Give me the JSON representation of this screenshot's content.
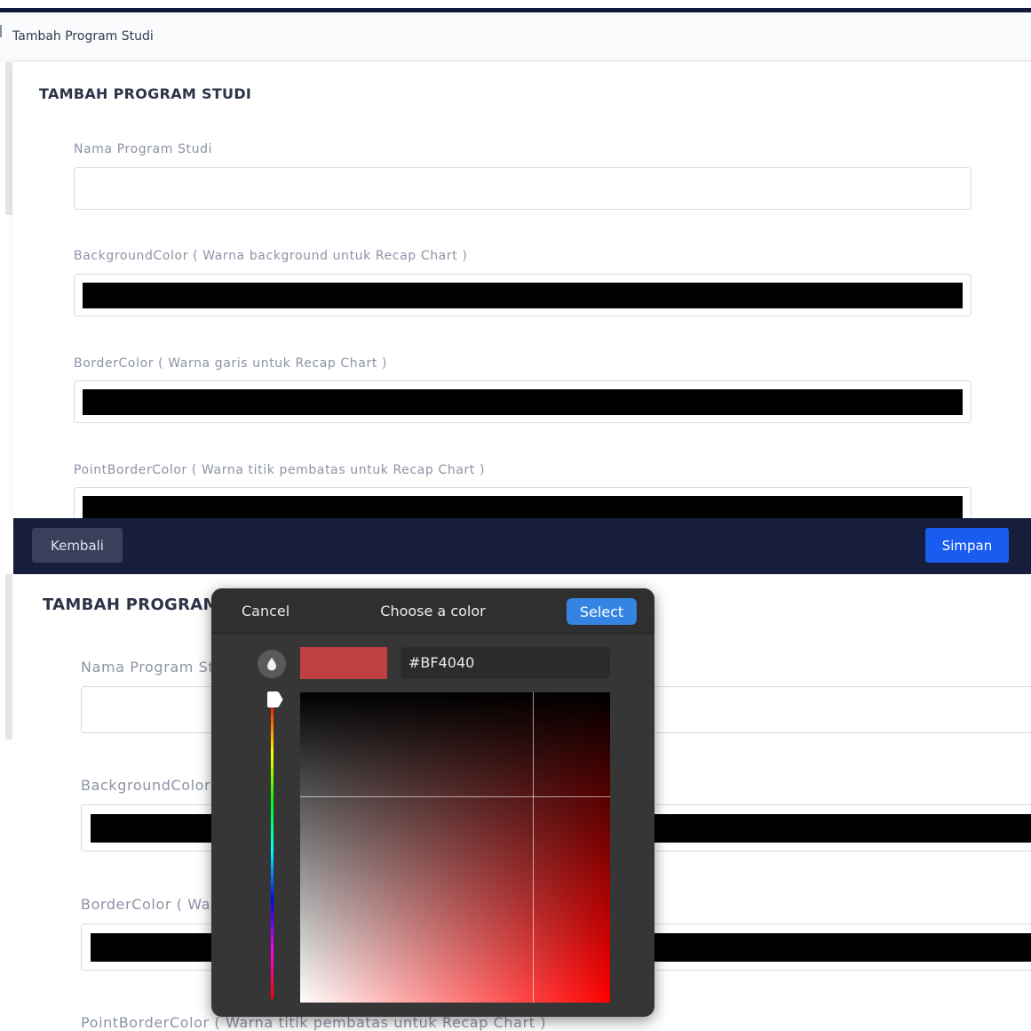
{
  "breadcrumb": "Tambah Program Studi",
  "form": {
    "title": "TAMBAH PROGRAM STUDI",
    "fields": [
      {
        "label": "Nama Program Studi",
        "value": ""
      },
      {
        "label": "BackgroundColor ( Warna background untuk Recap Chart )",
        "value": "#000000"
      },
      {
        "label": "BorderColor ( Warna garis untuk Recap Chart )",
        "value": "#000000"
      },
      {
        "label": "PointBorderColor ( Warna titik pembatas untuk Recap Chart )",
        "value": "#000000"
      }
    ]
  },
  "footer": {
    "back_label": "Kembali",
    "save_label": "Simpan"
  },
  "lower_form": {
    "title": "TAMBAH PROGRAM",
    "label_nama": "Nama Program Stu",
    "label_bg": "BackgroundColor (",
    "label_border": "BorderColor ( War",
    "label_point": "PointBorderColor ( Warna titik pembatas untuk Recap Chart )"
  },
  "color_dialog": {
    "cancel_label": "Cancel",
    "title": "Choose a color",
    "select_label": "Select",
    "hex_value": "#BF4040",
    "preview_color": "#BF4040",
    "icons": {
      "eyedropper": "eyedropper-icon",
      "hue_handle": "hue-slider-handle"
    }
  },
  "colors": {
    "nav_dark": "#161e3c",
    "primary": "#1a5cf0",
    "secondary_button": "#3a405c",
    "dialog_bg": "#363636",
    "dialog_accent": "#3584e4"
  }
}
